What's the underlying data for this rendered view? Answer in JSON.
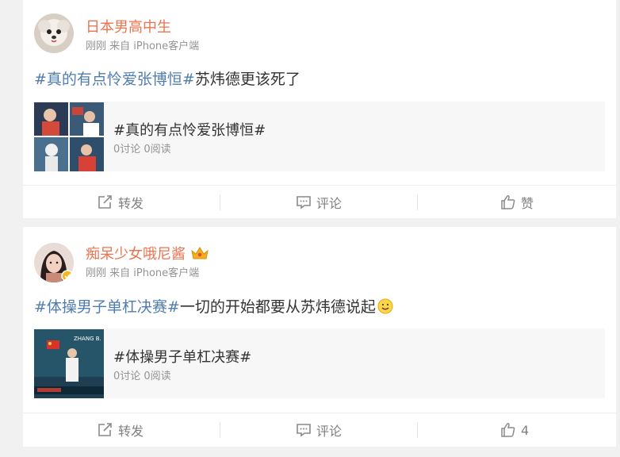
{
  "posts": [
    {
      "username": "日本男高中生",
      "meta": "刚刚 来自 iPhone客户端",
      "text_hashtag": "#真的有点怜爱张博恒#",
      "text_rest": "苏炜德更该死了",
      "topic": {
        "title": "#真的有点怜爱张博恒#",
        "stats": "0讨论 0阅读"
      },
      "actions": {
        "repost": "转发",
        "comment": "评论",
        "like": "赞"
      }
    },
    {
      "username": "痴呆少女哦尼酱",
      "meta": "刚刚 来自 iPhone客户端",
      "text_hashtag": "#体操男子单杠决赛#",
      "text_rest": "一切的开始都要从苏炜德说起",
      "topic": {
        "title": "#体操男子单杠决赛#",
        "stats": "0讨论 0阅读",
        "thumb_caption": "ZHANG B."
      },
      "actions": {
        "repost": "转发",
        "comment": "评论",
        "like": "4"
      }
    }
  ],
  "colors": {
    "username": "#eb7350",
    "hashtag": "#507daf",
    "meta": "#939393",
    "background": "#f1f1f1"
  },
  "icons": [
    "repost-icon",
    "comment-icon",
    "like-icon",
    "smile-emoji-icon",
    "vip-crown-icon"
  ]
}
